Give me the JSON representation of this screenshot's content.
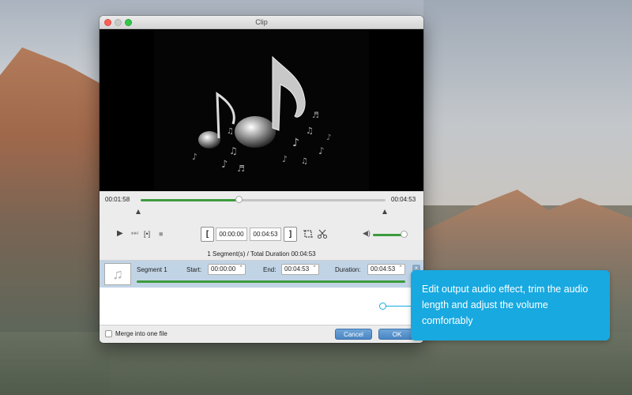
{
  "window": {
    "title": "Clip"
  },
  "player": {
    "current_time": "00:01:58",
    "total_time": "00:04:53",
    "progress": 0.402,
    "volume": 0.9
  },
  "toolbar": {
    "play_icon": "▶",
    "next_icon": "⏭",
    "frame_icon": "[•]",
    "stop_icon": "■",
    "set_start_label": "[",
    "set_end_label": "]",
    "start_time": "00:00:00",
    "end_time": "00:04:53",
    "crop_icon": "crop-icon",
    "cut_icon": "scissors-icon",
    "volume_icon": "◀)"
  },
  "summary": "1 Segment(s) / Total Duration 00:04:53",
  "segments": [
    {
      "name": "Segment 1",
      "start_label": "Start:",
      "start": "00:00:00",
      "end_label": "End:",
      "end": "00:04:53",
      "duration_label": "Duration:",
      "duration": "00:04:53",
      "thumb_icon": "♫",
      "close_icon": "×"
    }
  ],
  "footer": {
    "merge_label": "Merge into one file",
    "cancel_label": "Cancel",
    "ok_label": "OK"
  },
  "callout": {
    "text": "Edit output audio effect, trim the audio length and adjust the volume comfortably",
    "color": "#18a9e0"
  },
  "colors": {
    "accent_green": "#3d9b3d",
    "button_blue": "#4a86c4",
    "segment_bg": "#c1d4e6"
  }
}
